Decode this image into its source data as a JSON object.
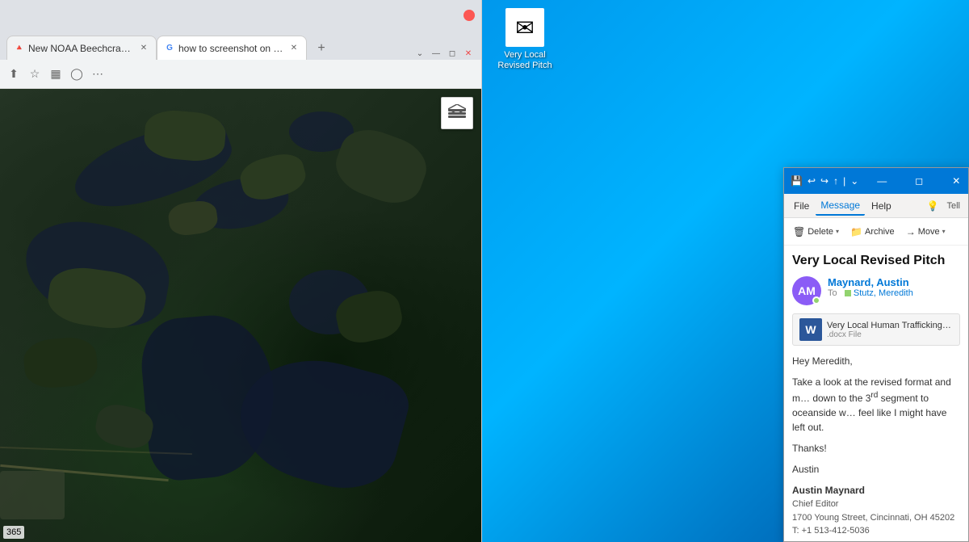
{
  "desktop": {
    "icon": {
      "label": "Very Local\nRevised Pitch",
      "icon_char": "✉"
    },
    "background_color": "#0078d7"
  },
  "browser": {
    "tabs": [
      {
        "favicon": "🔺",
        "title": "New NOAA Beechcraft Kin",
        "active": false
      },
      {
        "favicon": "G",
        "title": "how to screenshot on win",
        "active": true
      }
    ],
    "toolbar": {
      "share_icon": "⬆",
      "bookmark_icon": "☆",
      "sidebar_icon": "▦",
      "profile_icon": "◯",
      "menu_icon": "⋯"
    },
    "map": {
      "coord": "365",
      "layers_icon": "≡"
    }
  },
  "email": {
    "titlebar_icon": "💾",
    "ribbon_tabs": [
      "File",
      "Message",
      "Help"
    ],
    "active_tab": "Message",
    "toolbar_buttons": [
      {
        "icon": "🗑",
        "label": "Delete",
        "has_chevron": true
      },
      {
        "icon": "📁",
        "label": "Archive",
        "has_chevron": false
      },
      {
        "icon": "→",
        "label": "Move",
        "has_chevron": true
      }
    ],
    "subject": "Very Local Revised Pitch",
    "sender": {
      "initials": "AM",
      "name": "Maynard, Austin",
      "to_label": "To",
      "to_name": "Stutz, Meredith"
    },
    "attachment": {
      "name": "Very Local Human Trafficking Pitch.do",
      "type": ".docx File",
      "icon_text": "W"
    },
    "body": {
      "greeting": "Hey Meredith,",
      "paragraph1": "Take a look at the revised format and m… down to the 3rd segment to oceanside w… feel like I might have left out.",
      "sign_off": "Thanks!",
      "sign_name": "Austin",
      "signature": {
        "name": "Austin Maynard",
        "title": "Chief Editor",
        "address": "1700 Young Street, Cincinnati, OH 45202",
        "phone": "T: +1 513-412-5036"
      }
    }
  }
}
